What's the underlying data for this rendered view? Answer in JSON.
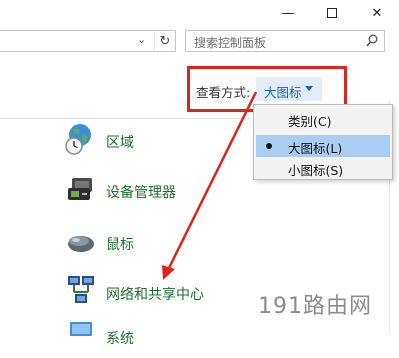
{
  "titlebar": {
    "minimize_icon": "minimize-icon",
    "maximize_icon": "maximize-icon",
    "close_icon": "close-icon",
    "minimize_glyph": "—",
    "close_glyph": "✕"
  },
  "address": {
    "chevron_glyph": "⌄",
    "refresh_glyph": "↻"
  },
  "search": {
    "placeholder": "搜索控制面板"
  },
  "view_by": {
    "label": "查看方式:",
    "value": "大图标"
  },
  "dropdown": {
    "items": [
      {
        "label": "类别(C)",
        "selected": false
      },
      {
        "label": "大图标(L)",
        "selected": true
      },
      {
        "label": "小图标(S)",
        "selected": false
      }
    ]
  },
  "items": [
    {
      "label": "区域",
      "icon": "region-globe-clock-icon"
    },
    {
      "label": "设备管理器",
      "icon": "device-manager-icon"
    },
    {
      "label": "鼠标",
      "icon": "mouse-icon"
    },
    {
      "label": "网络和共享中心",
      "icon": "network-sharing-icon"
    },
    {
      "label": "系统",
      "icon": "system-icon"
    }
  ],
  "colors": {
    "highlight": "#d9251d",
    "item_text": "#1f6f2f",
    "link_blue": "#1a62b5",
    "selected_bg": "#a9cdf3"
  },
  "watermark": {
    "text": "191路由网"
  }
}
